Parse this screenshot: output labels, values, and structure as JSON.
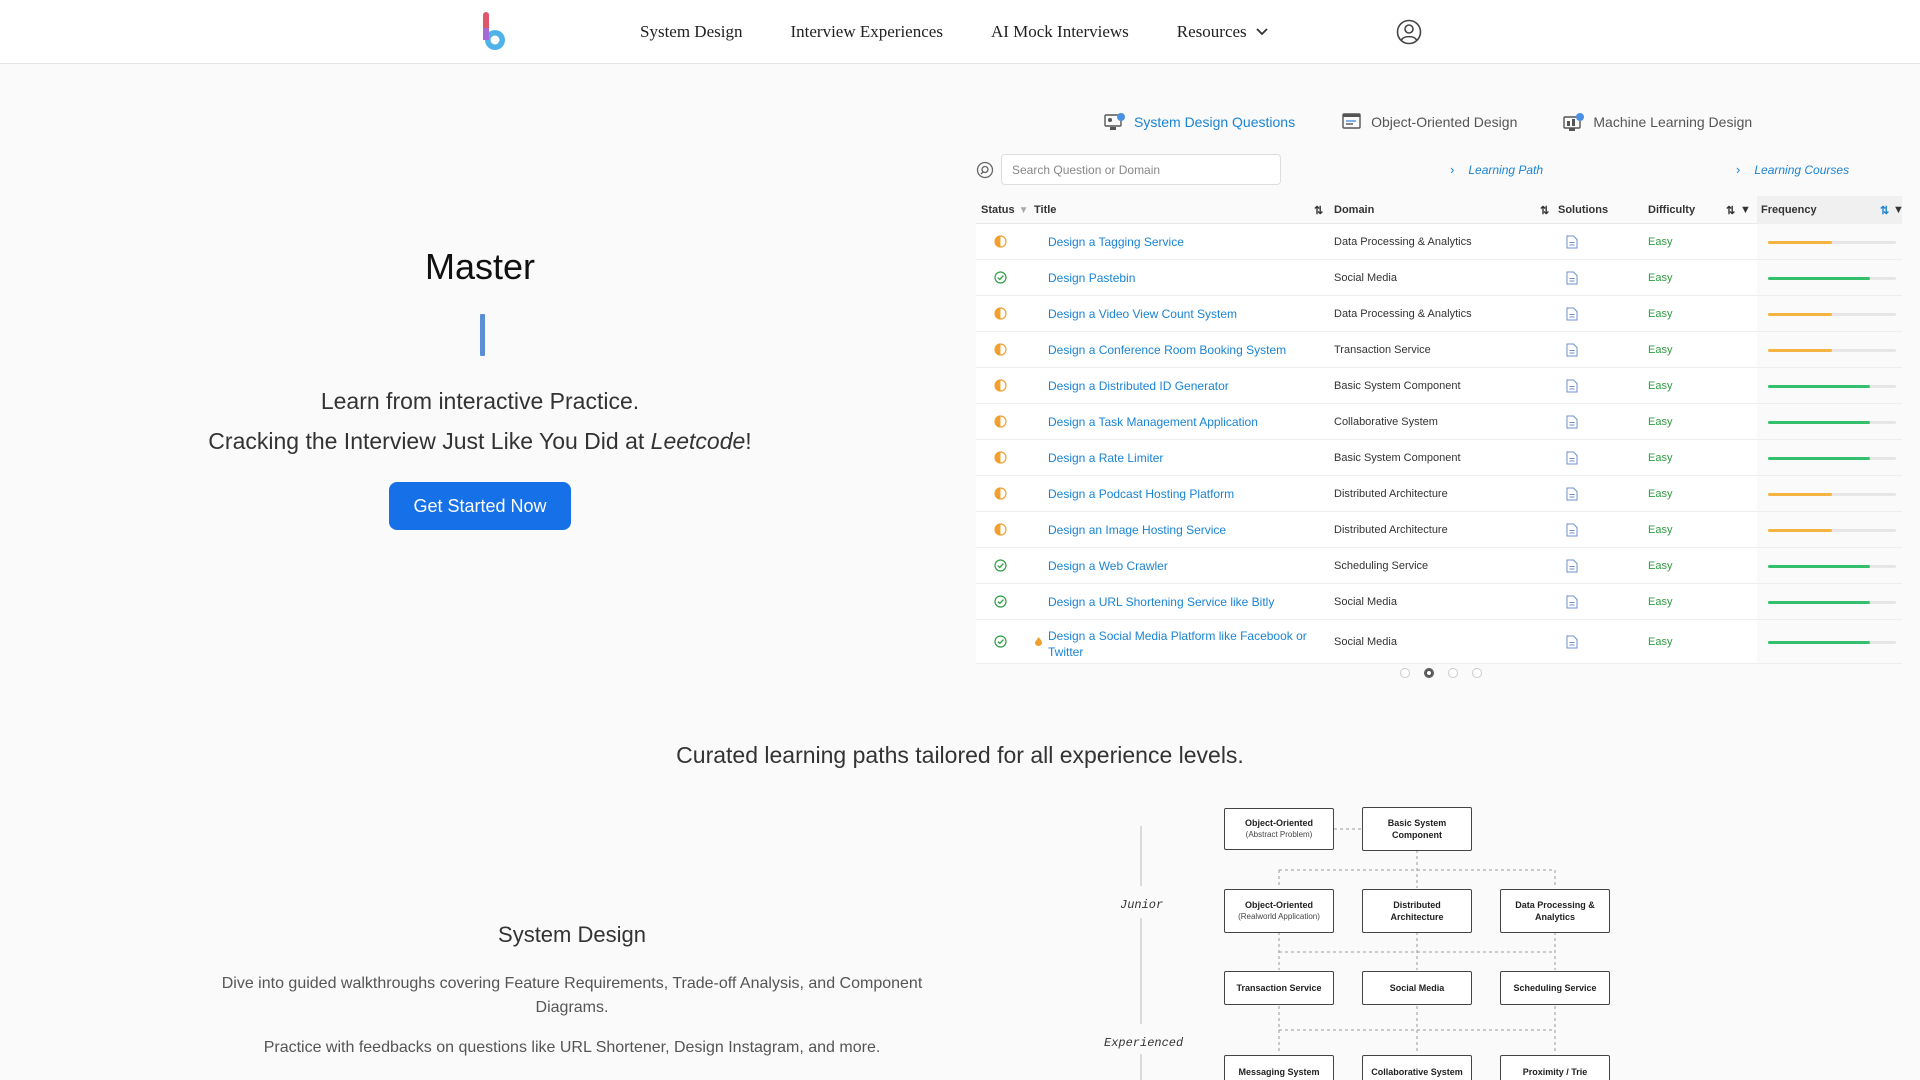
{
  "nav": {
    "items": [
      "System Design",
      "Interview Experiences",
      "AI Mock Interviews",
      "Resources"
    ]
  },
  "hero": {
    "title": "Master",
    "line1": "Learn from interactive Practice.",
    "line2_prefix": "Cracking the Interview Just Like You Did at ",
    "line2_em": "Leetcode",
    "line2_suffix": "!",
    "cta": "Get Started Now"
  },
  "tabs": [
    {
      "label": "System Design Questions",
      "active": true
    },
    {
      "label": "Object-Oriented Design",
      "active": false
    },
    {
      "label": "Machine Learning Design",
      "active": false
    }
  ],
  "search": {
    "placeholder": "Search Question or Domain"
  },
  "links": {
    "learning_path": "Learning Path",
    "learning_courses": "Learning Courses"
  },
  "table": {
    "headers": {
      "status": "Status",
      "title": "Title",
      "domain": "Domain",
      "solutions": "Solutions",
      "difficulty": "Difficulty",
      "frequency": "Frequency"
    },
    "rows": [
      {
        "status": "in-progress",
        "title": "Design a Tagging Service",
        "domain": "Data Processing & Analytics",
        "difficulty": "Easy",
        "frequency": 0.5,
        "freq_color": "#f5b342"
      },
      {
        "status": "done",
        "title": "Design Pastebin",
        "domain": "Social Media",
        "difficulty": "Easy",
        "frequency": 0.8,
        "freq_color": "#34c06a"
      },
      {
        "status": "in-progress",
        "title": "Design a Video View Count System",
        "domain": "Data Processing & Analytics",
        "difficulty": "Easy",
        "frequency": 0.5,
        "freq_color": "#f5b342"
      },
      {
        "status": "in-progress",
        "title": "Design a Conference Room Booking System",
        "domain": "Transaction Service",
        "difficulty": "Easy",
        "frequency": 0.5,
        "freq_color": "#f5b342"
      },
      {
        "status": "in-progress",
        "title": "Design a Distributed ID Generator",
        "domain": "Basic System Component",
        "difficulty": "Easy",
        "frequency": 0.8,
        "freq_color": "#34c06a"
      },
      {
        "status": "in-progress",
        "title": "Design a Task Management Application",
        "domain": "Collaborative System",
        "difficulty": "Easy",
        "frequency": 0.8,
        "freq_color": "#34c06a"
      },
      {
        "status": "in-progress",
        "title": "Design a Rate Limiter",
        "domain": "Basic System Component",
        "difficulty": "Easy",
        "frequency": 0.8,
        "freq_color": "#34c06a"
      },
      {
        "status": "in-progress",
        "title": "Design a Podcast Hosting Platform",
        "domain": "Distributed Architecture",
        "difficulty": "Easy",
        "frequency": 0.5,
        "freq_color": "#f5b342"
      },
      {
        "status": "in-progress",
        "title": "Design an Image Hosting Service",
        "domain": "Distributed Architecture",
        "difficulty": "Easy",
        "frequency": 0.5,
        "freq_color": "#f5b342"
      },
      {
        "status": "done",
        "title": "Design a Web Crawler",
        "domain": "Scheduling Service",
        "difficulty": "Easy",
        "frequency": 0.8,
        "freq_color": "#34c06a"
      },
      {
        "status": "done",
        "title": "Design a URL Shortening Service like Bitly",
        "domain": "Social Media",
        "difficulty": "Easy",
        "frequency": 0.8,
        "freq_color": "#34c06a"
      },
      {
        "status": "done",
        "title": "Design a Social Media Platform like Facebook or Twitter",
        "domain": "Social Media",
        "difficulty": "Easy",
        "frequency": 0.8,
        "freq_color": "#34c06a",
        "hot": true
      }
    ]
  },
  "section2": {
    "curated": "Curated learning paths tailored for all experience levels.",
    "title": "System Design",
    "desc1": "Dive into guided walkthroughs covering Feature Requirements, Trade-off Analysis, and Component Diagrams.",
    "desc2": "Practice with feedbacks on questions like URL Shortener, Design Instagram, and more."
  },
  "diagram": {
    "levels": [
      "Junior",
      "Experienced"
    ],
    "nodes": {
      "oo_abstract": {
        "title": "Object-Oriented",
        "sub": "(Abstract Problem)"
      },
      "basic": {
        "title": "Basic System Component",
        "sub": ""
      },
      "oo_real": {
        "title": "Object-Oriented",
        "sub": "(Realworld Application)"
      },
      "dist": {
        "title": "Distributed Architecture",
        "sub": ""
      },
      "data": {
        "title": "Data Processing & Analytics",
        "sub": ""
      },
      "trans": {
        "title": "Transaction Service",
        "sub": ""
      },
      "social": {
        "title": "Social Media",
        "sub": ""
      },
      "sched": {
        "title": "Scheduling Service",
        "sub": ""
      },
      "msg": {
        "title": "Messaging System",
        "sub": ""
      },
      "collab": {
        "title": "Collaborative System",
        "sub": ""
      },
      "prox": {
        "title": "Proximity / Trie",
        "sub": ""
      }
    }
  },
  "colors": {
    "accent": "#1670e8",
    "link": "#1a84d4",
    "easy": "#2f9e44"
  }
}
